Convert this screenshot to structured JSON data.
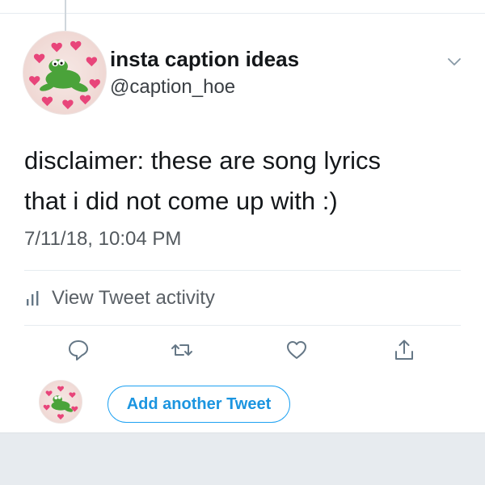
{
  "tweet": {
    "author": {
      "display_name": "insta caption ideas",
      "handle": "@caption_hoe"
    },
    "text_lines": [
      "disclaimer: these are song lyrics",
      "that i did not come up with :)"
    ],
    "timestamp": "7/11/18, 10:04 PM"
  },
  "activity": {
    "label": "View Tweet activity",
    "icon": "bar-chart-icon"
  },
  "actions": [
    {
      "name": "reply",
      "icon": "reply-icon"
    },
    {
      "name": "retweet",
      "icon": "retweet-icon"
    },
    {
      "name": "like",
      "icon": "heart-icon"
    },
    {
      "name": "share",
      "icon": "share-icon"
    }
  ],
  "composer": {
    "add_tweet_label": "Add another Tweet"
  },
  "colors": {
    "accent": "#1da1f2",
    "text": "#14171a",
    "secondary_text": "#53595e",
    "icon": "#657786",
    "divider": "#e6ecf0",
    "bottom_bar": "#e7ebef"
  }
}
